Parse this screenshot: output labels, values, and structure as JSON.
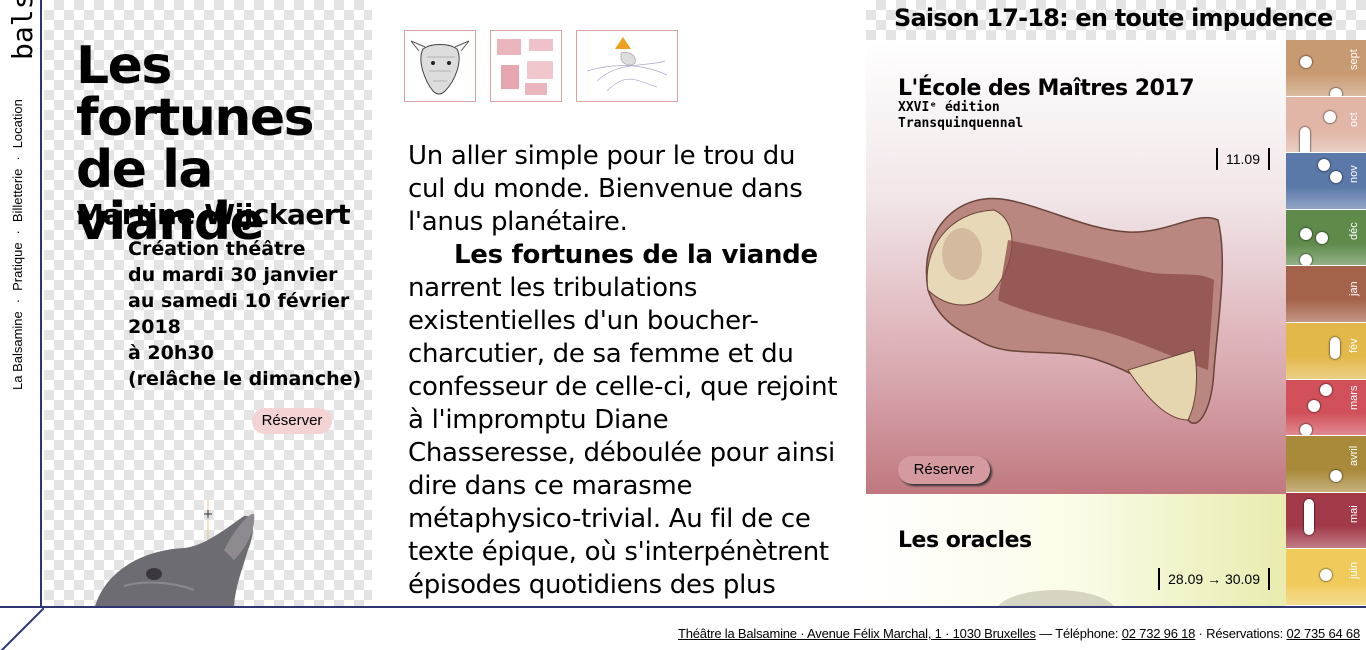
{
  "brand": {
    "logo_text": "balsamine"
  },
  "nav": {
    "items": [
      "La Balsamine",
      "Pratique",
      "Billetterie",
      "Location"
    ],
    "separator": "·"
  },
  "show": {
    "title": "Les fortunes de la viande",
    "author": "Martine Wijckaert",
    "details": [
      "Création théâtre",
      "du mardi 30 janvier",
      "au samedi 10 février",
      "2018",
      "à 20h30",
      "(relâche le dimanche)"
    ],
    "reserve_label": "Réserver"
  },
  "thumbnails": [
    "thumbnail-deer-head",
    "thumbnail-meat-cuts",
    "thumbnail-sketch"
  ],
  "description": {
    "intro": "Un aller simple pour le trou du cul du monde. Bienvenue dans l'anus planétaire.",
    "lead_title": "Les fortunes de la viande",
    "body": "narrent les tribulations existentielles d'un boucher-charcutier, de sa femme et du confesseur de celle-ci, que rejoint à l'impromptu Diane Chasseresse, déboulée pour ainsi dire dans ce marasme métaphysico-trivial. Au fil de ce texte épique, où s'interpénètrent épisodes quotidiens des plus"
  },
  "season": {
    "title": "Saison 17-18: en toute impudence",
    "cards": [
      {
        "title": "L'École des Maîtres 2017",
        "subtitle_lines": [
          "XXVIᵉ édition",
          "Transquinquennal"
        ],
        "date": "11.09",
        "reserve_label": "Réserver"
      },
      {
        "title": "Les oracles",
        "date": "28.09 → 30.09"
      }
    ]
  },
  "timeline": {
    "months": [
      {
        "label": "sept",
        "color": "#c89a72"
      },
      {
        "label": "oct",
        "color": "#e1b6a6"
      },
      {
        "label": "nov",
        "color": "#5a78a8"
      },
      {
        "label": "déc",
        "color": "#5e8a4a"
      },
      {
        "label": "jan",
        "color": "#a4624a"
      },
      {
        "label": "fév",
        "color": "#e2b84a"
      },
      {
        "label": "mars",
        "color": "#d1505a"
      },
      {
        "label": "avril",
        "color": "#a88a3a"
      },
      {
        "label": "mai",
        "color": "#a23a4a"
      },
      {
        "label": "juin",
        "color": "#f0ca5a"
      }
    ]
  },
  "footer": {
    "address": "Théâtre la Balsamine · Avenue Félix Marchal, 1 · 1030 Bruxelles",
    "phone_label": "— Téléphone:",
    "phone": "02 732 96 18",
    "reservations_label": "· Réservations:",
    "reservations": "02 735 64 68"
  }
}
